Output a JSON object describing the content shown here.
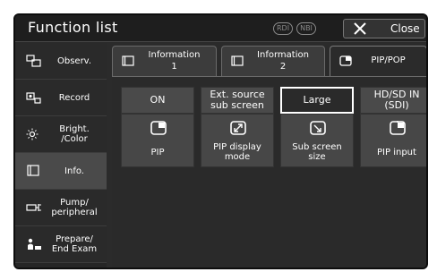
{
  "window": {
    "title": "Function list",
    "mode_badges": [
      "RDI",
      "NBI"
    ],
    "close_label": "Close"
  },
  "sidebar": {
    "items": [
      {
        "label": "Observ.",
        "icon": "observation-icon"
      },
      {
        "label": "Record",
        "icon": "record-icon"
      },
      {
        "label": "Bright.\n/Color",
        "icon": "brightness-icon"
      },
      {
        "label": "Info.",
        "icon": "info-icon",
        "active": true
      },
      {
        "label": "Pump/\nperipheral",
        "icon": "pump-icon"
      },
      {
        "label": "Prepare/\nEnd Exam",
        "icon": "prepare-icon"
      }
    ]
  },
  "tabs": [
    {
      "label": "Information\n1",
      "icon": "information-screen-icon"
    },
    {
      "label": "Information\n2",
      "icon": "information-screen-icon"
    },
    {
      "label": "PIP/POP",
      "icon": "pip-icon",
      "active": true
    }
  ],
  "functions": [
    {
      "value": "ON",
      "label": "PIP",
      "icon": "pip-icon"
    },
    {
      "value": "Ext. source\nsub screen",
      "label": "PIP display\nmode",
      "icon": "pip-display-mode-icon"
    },
    {
      "value": "Large",
      "label": "Sub screen\nsize",
      "icon": "sub-screen-size-icon",
      "highlighted": true
    },
    {
      "value": "HD/SD IN\n(SDI)",
      "label": "PIP input",
      "icon": "pip-input-icon"
    }
  ]
}
